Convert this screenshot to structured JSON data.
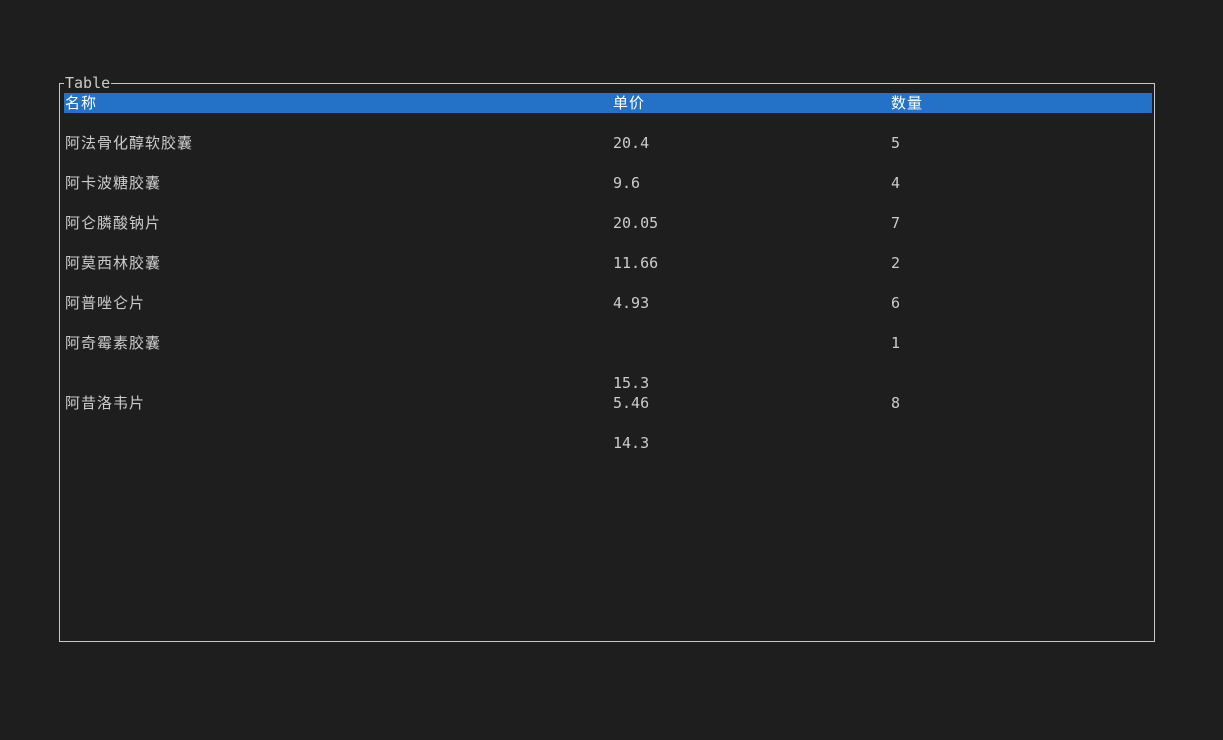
{
  "table": {
    "title": "Table",
    "columns": [
      "名称",
      "单价",
      "数量"
    ],
    "rows": [
      {
        "name": "阿法骨化醇软胶囊",
        "price": [
          "20.4"
        ],
        "qty": "5"
      },
      {
        "name": "阿卡波糖胶囊",
        "price": [
          "9.6"
        ],
        "qty": "4"
      },
      {
        "name": "阿仑膦酸钠片",
        "price": [
          "20.05"
        ],
        "qty": "7"
      },
      {
        "name": "阿莫西林胶囊",
        "price": [
          "11.66"
        ],
        "qty": "2"
      },
      {
        "name": "阿普唑仑片",
        "price": [
          "4.93"
        ],
        "qty": "6"
      },
      {
        "name": "阿奇霉素胶囊",
        "price": [
          "15.3",
          "14.3"
        ],
        "qty": "1"
      },
      {
        "name": "阿昔洛韦片",
        "price": [
          "5.46"
        ],
        "qty": "8"
      }
    ]
  },
  "colors": {
    "background": "#1e1e1e",
    "header_highlight": "#2472c8",
    "text": "#cccccc",
    "border": "#c8c8c8"
  }
}
